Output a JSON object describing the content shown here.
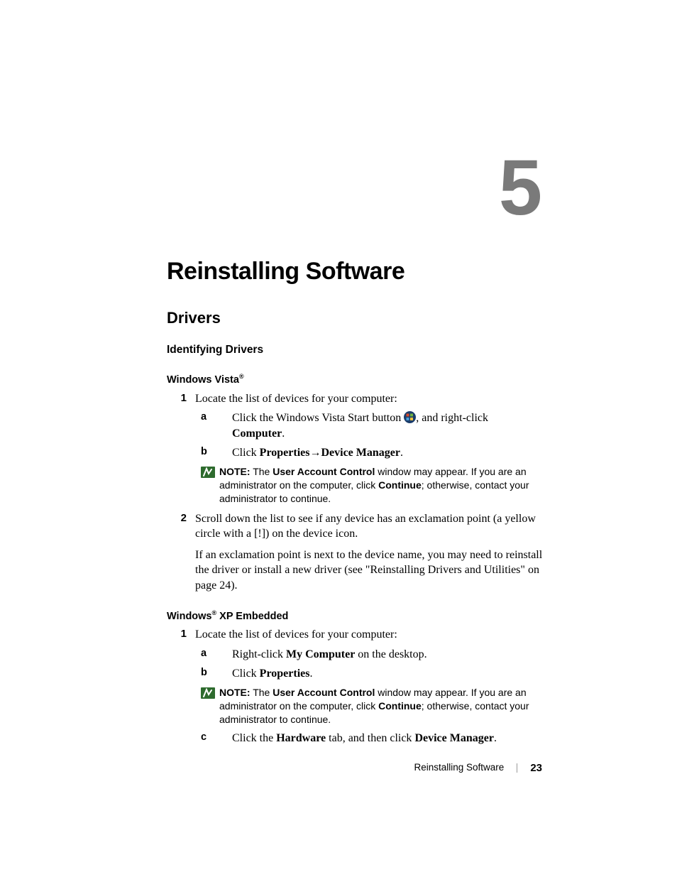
{
  "chapter": {
    "number": "5",
    "title": "Reinstalling Software"
  },
  "section": {
    "title": "Drivers"
  },
  "subsection": {
    "title": "Identifying Drivers"
  },
  "vista": {
    "heading_pre": "Windows Vista",
    "heading_suffix": "®",
    "step1": {
      "marker": "1",
      "text": "Locate the list of devices for your computer:",
      "a": {
        "marker": "a",
        "pre": "Click the Windows Vista Start button ",
        "post": ", and right-click ",
        "bold": "Computer",
        "end": "."
      },
      "b": {
        "marker": "b",
        "pre": "Click ",
        "bold1": "Properties",
        "arrow": "→",
        "bold2": "Device Manager",
        "end": "."
      },
      "note": {
        "label": "NOTE:",
        "t1": " The ",
        "b1": "User Account Control",
        "t2": " window may appear. If you are an administrator on the computer, click ",
        "b2": "Continue",
        "t3": "; otherwise, contact your administrator to continue."
      }
    },
    "step2": {
      "marker": "2",
      "para1": "Scroll down the list to see if any device has an exclamation point (a yellow circle with a [!]) on the device icon.",
      "para2": "If an exclamation point is next to the device name, you may need to reinstall the driver or install a new driver (see \"Reinstalling Drivers and Utilities\" on page 24)."
    }
  },
  "xpe": {
    "heading_pre": "Windows",
    "heading_sup": "®",
    "heading_post": " XP Embedded",
    "step1": {
      "marker": "1",
      "text": "Locate the list of devices for your computer:",
      "a": {
        "marker": "a",
        "pre": "Right-click ",
        "bold": "My Computer",
        "post": " on the desktop."
      },
      "b": {
        "marker": "b",
        "pre": "Click ",
        "bold": "Properties",
        "post": "."
      },
      "note": {
        "label": "NOTE:",
        "t1": " The ",
        "b1": "User Account Control",
        "t2": " window may appear. If you are an administrator on the computer, click ",
        "b2": "Continue",
        "t3": "; otherwise, contact your administrator to continue."
      },
      "c": {
        "marker": "c",
        "pre": "Click the ",
        "bold1": "Hardware",
        "mid": " tab, and then click ",
        "bold2": "Device Manager",
        "post": "."
      }
    }
  },
  "footer": {
    "section": "Reinstalling Software",
    "page": "23"
  }
}
